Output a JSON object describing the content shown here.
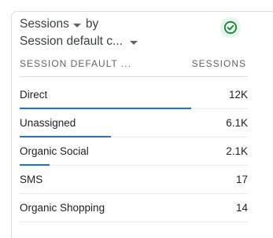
{
  "card": {
    "title_metric": "Sessions",
    "title_by": "by",
    "title_dimension": "Session default c...",
    "status_icon": "check-circle-icon",
    "status_color": "#188038"
  },
  "table": {
    "dimension_header": "SESSION DEFAULT ...",
    "metric_header": "SESSIONS",
    "accent_color": "#1a73e8",
    "rows": [
      {
        "label": "Direct",
        "value": "12K",
        "share": 0.75
      },
      {
        "label": "Unassigned",
        "value": "6.1K",
        "share": 0.4
      },
      {
        "label": "Organic Social",
        "value": "2.1K",
        "share": 0.13
      },
      {
        "label": "SMS",
        "value": "17",
        "share": 0.001
      },
      {
        "label": "Organic Shopping",
        "value": "14",
        "share": 0.001
      }
    ]
  }
}
